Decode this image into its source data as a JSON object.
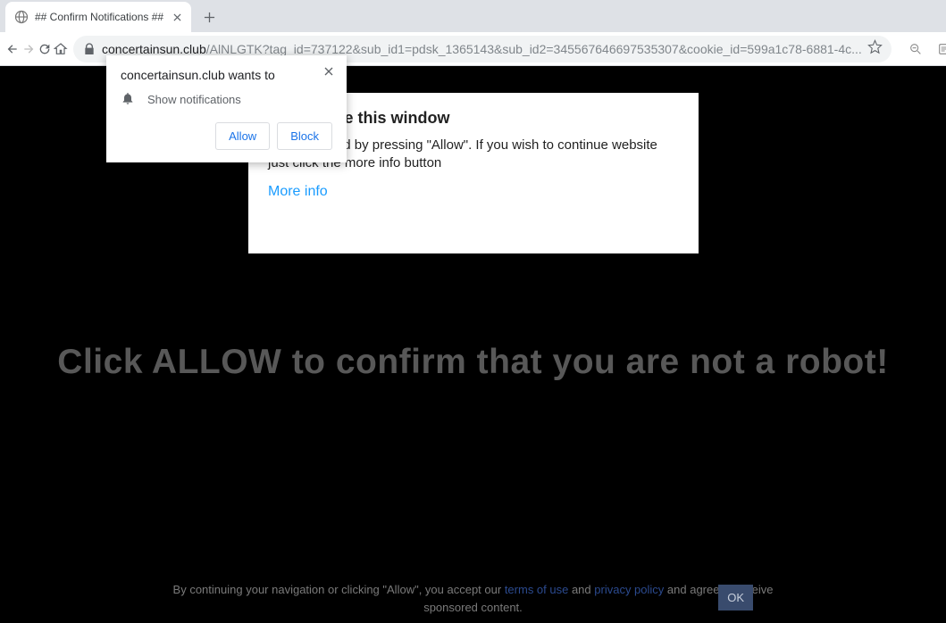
{
  "window": {
    "tab_title": "## Confirm Notifications ##"
  },
  "omnibox": {
    "domain": "concertainsun.club",
    "path": "/AlNLGTK?tag_id=737122&sub_id1=pdsk_1365143&sub_id2=345567646697535307&cookie_id=599a1c78-6881-4c..."
  },
  "perm": {
    "title": "concertainsun.club wants to",
    "line": "Show notifications",
    "allow": "Allow",
    "block": "Block"
  },
  "whitebox": {
    "title": "w\" to close this window",
    "body": "can be closed by pressing \"Allow\". If you wish to continue website just click the more info button",
    "more": "More info"
  },
  "big_text": "Click ALLOW to confirm that you are not a robot!",
  "footer": {
    "pre": "By continuing your navigation or clicking \"Allow\", you accept our ",
    "terms": "terms of use",
    "and": " and ",
    "privacy": "privacy policy",
    "post": " and agree to receive sponsored content.",
    "ok": "OK"
  }
}
